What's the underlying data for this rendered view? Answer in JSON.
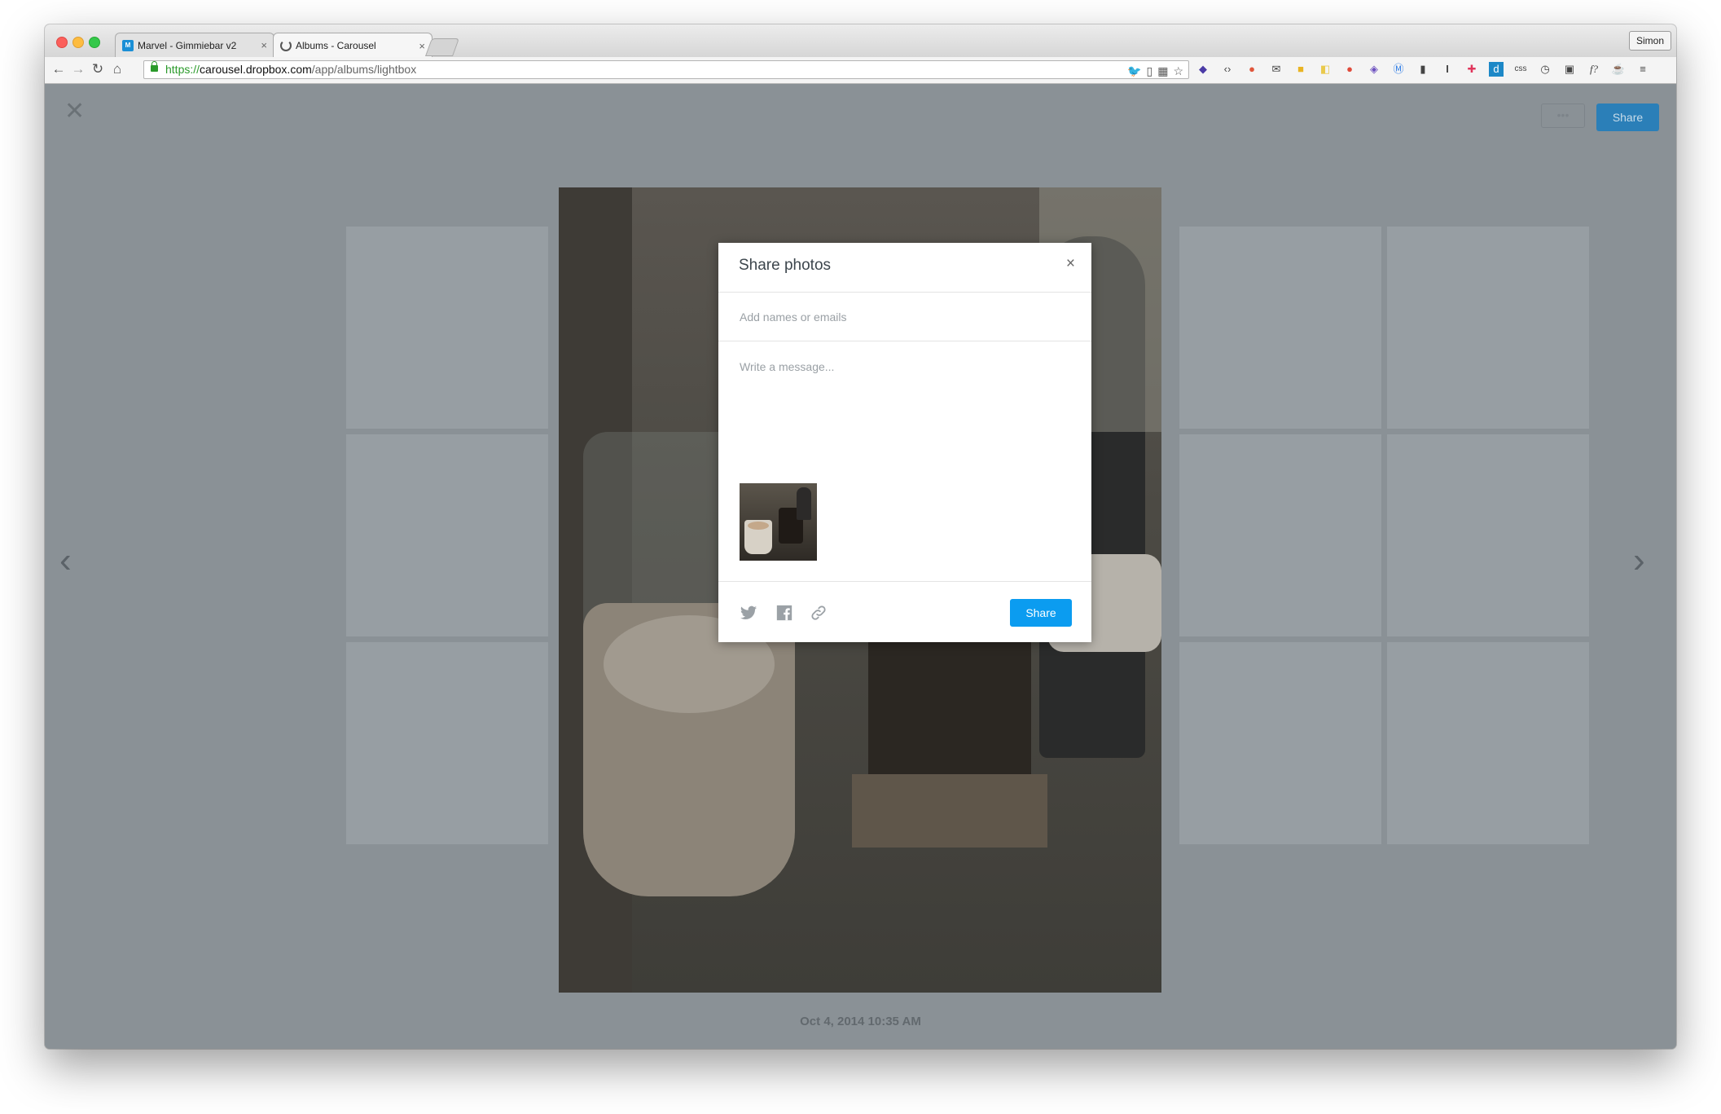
{
  "browser": {
    "tabs": [
      {
        "title": "Marvel - Gimmiebar v2",
        "active": false
      },
      {
        "title": "Albums - Carousel",
        "active": true
      }
    ],
    "profile_name": "Simon",
    "url": {
      "scheme": "https://",
      "host": "carousel.dropbox.com",
      "path": "/app/albums/lightbox"
    }
  },
  "page": {
    "more_button_label": "•••",
    "share_button_label": "Share",
    "photo_date": "Oct 4, 2014 10:35 AM"
  },
  "modal": {
    "title": "Share photos",
    "close_label": "×",
    "recipients_placeholder": "Add names or emails",
    "message_placeholder": "Write a message...",
    "share_label": "Share"
  },
  "colors": {
    "accent": "#0b9cf0",
    "overlay": "#8a9196"
  }
}
